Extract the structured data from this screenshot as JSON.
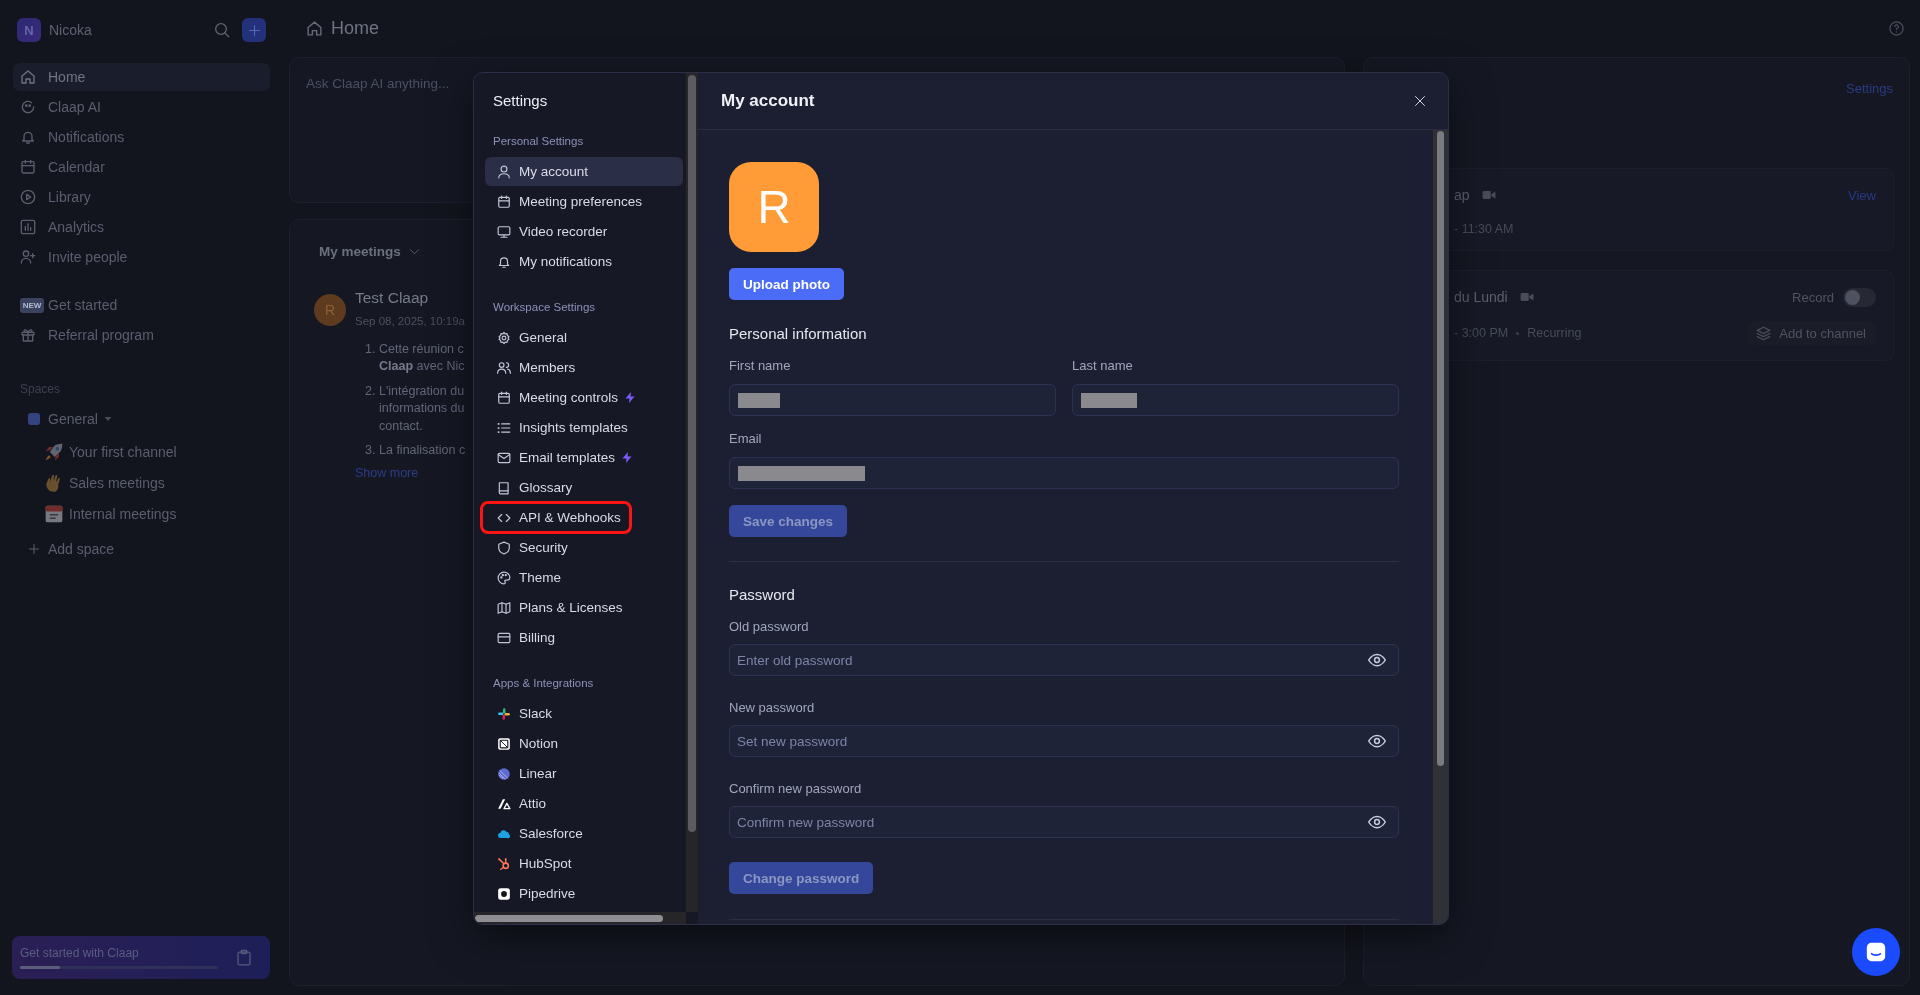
{
  "sidebar": {
    "workspace": {
      "initial": "N",
      "name": "Nicoka"
    },
    "nav": [
      {
        "label": "Home",
        "selected": true
      },
      {
        "label": "Claap AI",
        "selected": false
      },
      {
        "label": "Notifications",
        "selected": false
      },
      {
        "label": "Calendar",
        "selected": false
      },
      {
        "label": "Library",
        "selected": false
      },
      {
        "label": "Analytics",
        "selected": false
      },
      {
        "label": "Invite people",
        "selected": false
      }
    ],
    "shortcuts": [
      {
        "label": "Get started",
        "badge": "NEW"
      },
      {
        "label": "Referral program"
      }
    ],
    "spaces_heading": "Spaces",
    "spaces": [
      {
        "label": "General",
        "color": "#34427f",
        "expanded": true,
        "children": [
          {
            "label": "Your first channel"
          },
          {
            "label": "Sales meetings"
          },
          {
            "label": "Internal meetings"
          }
        ]
      }
    ],
    "add_space": "Add space",
    "onboarding": {
      "title": "Get started with Claap",
      "level": 0.2
    }
  },
  "header": {
    "title": "Home"
  },
  "ask_ai": {
    "placeholder": "Ask Claap AI anything..."
  },
  "meetings": {
    "filter": "My meetings",
    "items": [
      {
        "initial": "R",
        "title": "Test Claap",
        "date": "Sep 08, 2025, 10:19a",
        "summary": [
          {
            "number": "1.",
            "lines": [
              "Cette réunion c",
              "**Claap** avec Nic"
            ]
          },
          {
            "number": "2.",
            "lines": [
              "L'intégration du",
              "informations du",
              "contact."
            ]
          },
          {
            "number": "3.",
            "lines": [
              "La finalisation c"
            ]
          }
        ],
        "more": "Show more"
      }
    ]
  },
  "upcoming": {
    "link": "Settings",
    "events": [
      {
        "title": "ap",
        "time": "- 11:30 AM",
        "link": "View"
      },
      {
        "title": "du Lundi",
        "time": "- 3:00 PM",
        "recurrence": "Recurring",
        "record": {
          "label": "Record",
          "on": false
        },
        "channel_button": "Add to channel"
      }
    ]
  },
  "settings": {
    "title": "Settings",
    "sections": [
      {
        "heading": "Personal Settings",
        "items": [
          {
            "label": "My account",
            "selected": true,
            "highlighted": false,
            "bolt": false
          },
          {
            "label": "Meeting preferences",
            "selected": false,
            "highlighted": false,
            "bolt": false
          },
          {
            "label": "Video recorder",
            "selected": false,
            "highlighted": false,
            "bolt": false
          },
          {
            "label": "My notifications",
            "selected": false,
            "highlighted": false,
            "bolt": false
          }
        ]
      },
      {
        "heading": "Workspace Settings",
        "items": [
          {
            "label": "General",
            "selected": false,
            "highlighted": false,
            "bolt": false
          },
          {
            "label": "Members",
            "selected": false,
            "highlighted": false,
            "bolt": false
          },
          {
            "label": "Meeting controls",
            "selected": false,
            "highlighted": false,
            "bolt": true
          },
          {
            "label": "Insights templates",
            "selected": false,
            "highlighted": false,
            "bolt": false
          },
          {
            "label": "Email templates",
            "selected": false,
            "highlighted": false,
            "bolt": true
          },
          {
            "label": "Glossary",
            "selected": false,
            "highlighted": false,
            "bolt": false
          },
          {
            "label": "API & Webhooks",
            "selected": false,
            "highlighted": true,
            "bolt": false
          },
          {
            "label": "Security",
            "selected": false,
            "highlighted": false,
            "bolt": false
          },
          {
            "label": "Theme",
            "selected": false,
            "highlighted": false,
            "bolt": false
          },
          {
            "label": "Plans & Licenses",
            "selected": false,
            "highlighted": false,
            "bolt": false
          },
          {
            "label": "Billing",
            "selected": false,
            "highlighted": false,
            "bolt": false
          }
        ]
      },
      {
        "heading": "Apps & Integrations",
        "items": [
          {
            "label": "Slack",
            "selected": false,
            "highlighted": false,
            "bolt": false
          },
          {
            "label": "Notion",
            "selected": false,
            "highlighted": false,
            "bolt": false
          },
          {
            "label": "Linear",
            "selected": false,
            "highlighted": false,
            "bolt": false
          },
          {
            "label": "Attio",
            "selected": false,
            "highlighted": false,
            "bolt": false
          },
          {
            "label": "Salesforce",
            "selected": false,
            "highlighted": false,
            "bolt": false
          },
          {
            "label": "HubSpot",
            "selected": false,
            "highlighted": false,
            "bolt": false
          },
          {
            "label": "Pipedrive",
            "selected": false,
            "highlighted": false,
            "bolt": false
          }
        ]
      }
    ],
    "page": {
      "title": "My account",
      "avatar": "R",
      "upload": "Upload photo",
      "personal": {
        "heading": "Personal information",
        "fields": [
          {
            "label": "First name",
            "redacted": true
          },
          {
            "label": "Last name",
            "redacted": true
          },
          {
            "label": "Email",
            "redacted": true
          }
        ],
        "save": {
          "label": "Save changes",
          "disabled": true
        }
      },
      "password": {
        "heading": "Password",
        "fields": [
          {
            "label": "Old password",
            "placeholder": "Enter old password"
          },
          {
            "label": "New password",
            "placeholder": "Set new password"
          },
          {
            "label": "Confirm new password",
            "placeholder": "Confirm new password"
          }
        ],
        "submit": {
          "label": "Change password",
          "disabled": true
        }
      }
    }
  }
}
